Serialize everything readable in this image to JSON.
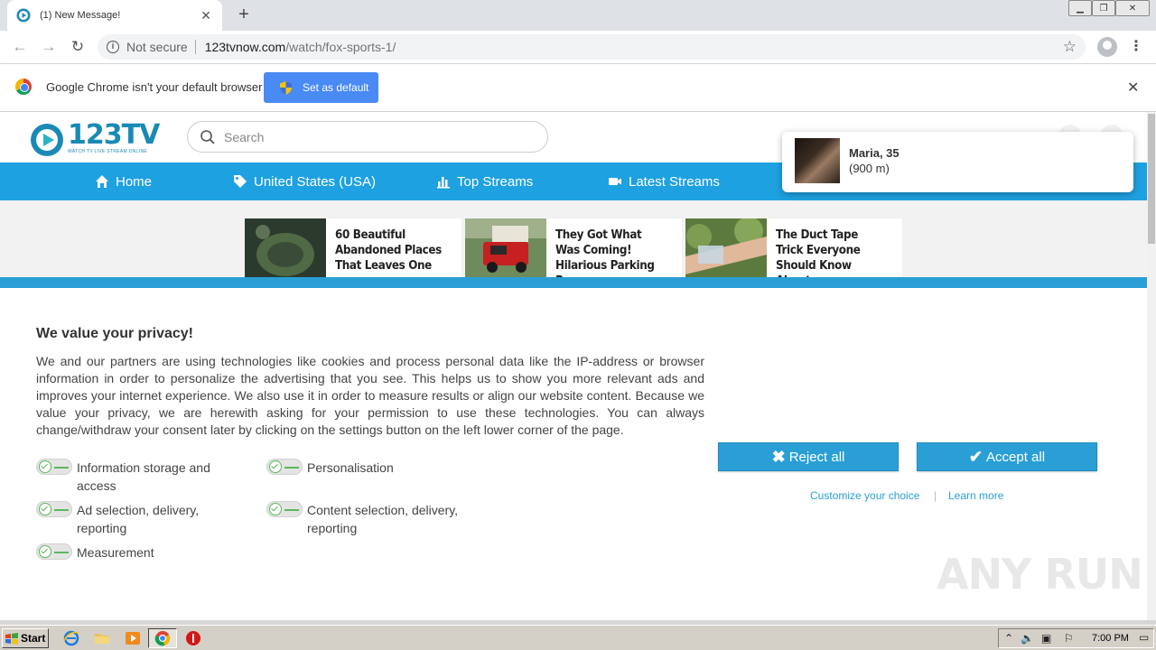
{
  "browser": {
    "tab_title": "(1) New Message!",
    "not_secure_label": "Not secure",
    "url_host": "123tvnow.com",
    "url_path": "/watch/fox-sports-1/",
    "infobar_text": "Google Chrome isn't your default browser",
    "set_default_label": "Set as default"
  },
  "site": {
    "logo_text": "123TV",
    "logo_subtitle": "WATCH TV LIVE STREAM ONLINE",
    "search_placeholder": "Search",
    "nav": [
      {
        "label": "Home",
        "icon": "home-icon"
      },
      {
        "label": "United States (USA)",
        "icon": "tag-icon"
      },
      {
        "label": "Top Streams",
        "icon": "bar-chart-icon"
      },
      {
        "label": "Latest Streams",
        "icon": "video-camera-icon"
      }
    ],
    "ads": [
      {
        "title": "60 Beautiful Abandoned Places That Leaves One"
      },
      {
        "title": "They Got What Was Coming! Hilarious Parking Revenge"
      },
      {
        "title": "The Duct Tape Trick Everyone Should Know About"
      }
    ]
  },
  "notification": {
    "name": "Maria, 35",
    "distance": "(900 m)"
  },
  "consent": {
    "title": "We value your privacy!",
    "body": "We and our partners are using technologies like cookies and process personal data like the IP-address or browser information in order to personalize the advertising that you see. This helps us to show you more relevant ads and improves your internet experience. We also use it in order to measure results or align our website content. Because we value your privacy, we are herewith asking for your permission to use these technologies. You can always change/withdraw your consent later by clicking on the settings button on the left lower corner of the page.",
    "purposes": [
      {
        "label": "Information storage and access",
        "enabled": true
      },
      {
        "label": "Personalisation",
        "enabled": true
      },
      {
        "label": "Ad selection, delivery, reporting",
        "enabled": true
      },
      {
        "label": "Content selection, delivery, reporting",
        "enabled": true
      },
      {
        "label": "Measurement",
        "enabled": true
      }
    ],
    "reject_label": "Reject all",
    "accept_label": "Accept all",
    "customize_label": "Customize your choice",
    "learn_more_label": "Learn more",
    "separator": "|",
    "accent_color": "#2a9fd6"
  },
  "watermark": "ANY RUN",
  "taskbar": {
    "start_label": "Start",
    "clock": "7:00 PM"
  }
}
